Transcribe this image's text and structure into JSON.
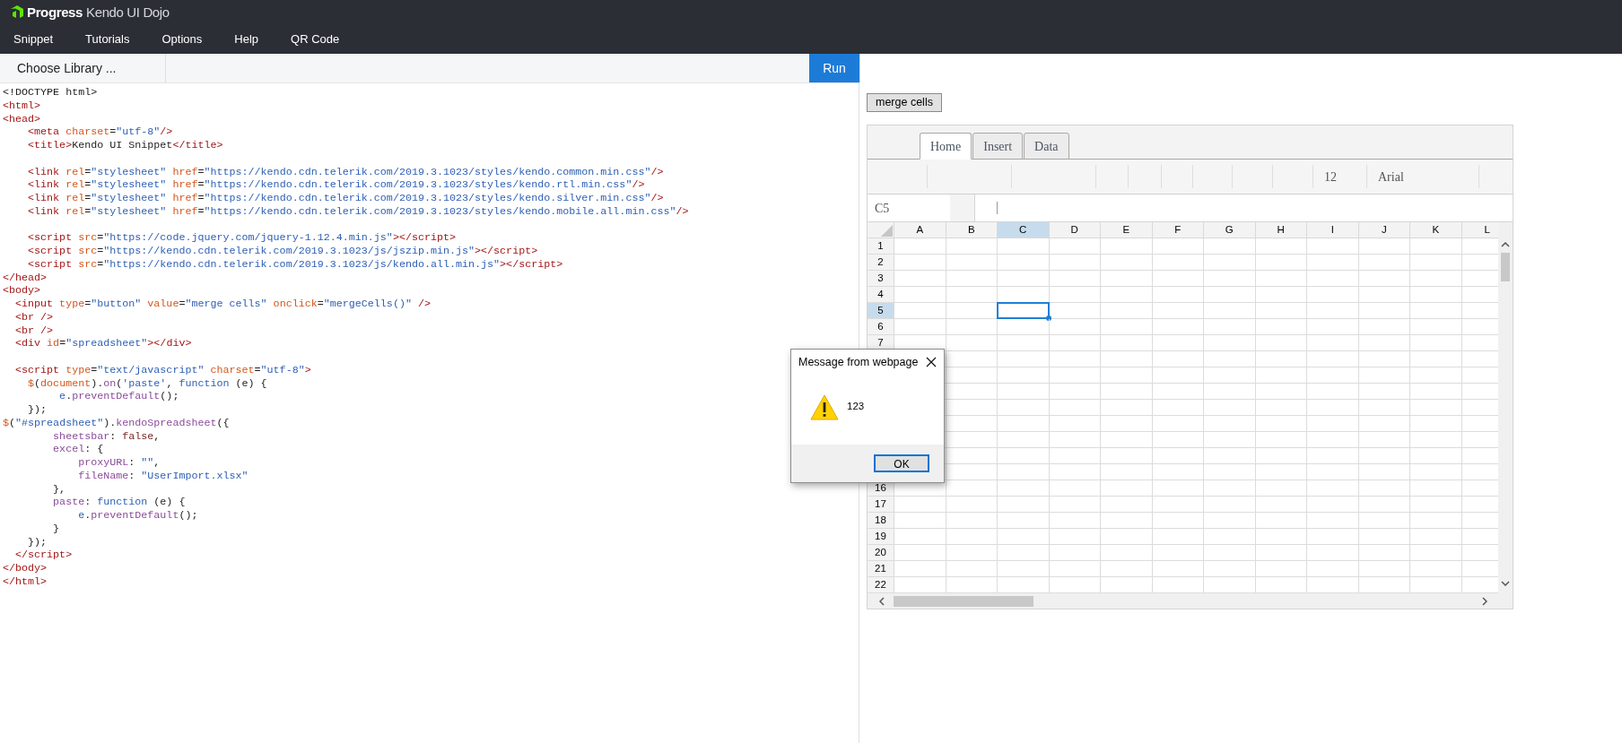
{
  "header": {
    "logo": {
      "brand": "Progress",
      "product": "Kendo UI",
      "suffix": "Dojo"
    },
    "menu": [
      "Snippet",
      "Tutorials",
      "Options",
      "Help",
      "QR Code"
    ]
  },
  "toolbar": {
    "library_button": "Choose Library ...",
    "run_button": "Run"
  },
  "code_lines": [
    {
      "kind": "code",
      "tokens": [
        {
          "text": "<!DOCTYPE html>",
          "kind": "plain"
        }
      ]
    },
    {
      "kind": "code",
      "tokens": [
        {
          "text": "<html>",
          "kind": "tag"
        }
      ]
    },
    {
      "kind": "code",
      "tokens": [
        {
          "text": "<head>",
          "kind": "tag"
        }
      ]
    },
    {
      "kind": "code",
      "tokens": [
        {
          "text": "    <meta",
          "kind": "tag"
        },
        {
          "text": " charset",
          "kind": "attr"
        },
        {
          "text": "=",
          "kind": "plain"
        },
        {
          "text": "\"utf-8\"",
          "kind": "string"
        },
        {
          "text": "/>",
          "kind": "tag"
        }
      ]
    },
    {
      "kind": "code",
      "tokens": [
        {
          "text": "    <title>",
          "kind": "tag"
        },
        {
          "text": "Kendo UI Snippet",
          "kind": "plain"
        },
        {
          "text": "</title>",
          "kind": "tag"
        }
      ]
    },
    {
      "kind": "blank"
    },
    {
      "kind": "code",
      "tokens": [
        {
          "text": "    <link",
          "kind": "tag"
        },
        {
          "text": " rel",
          "kind": "attr"
        },
        {
          "text": "=",
          "kind": "plain"
        },
        {
          "text": "\"stylesheet\"",
          "kind": "string"
        },
        {
          "text": " href",
          "kind": "attr"
        },
        {
          "text": "=",
          "kind": "plain"
        },
        {
          "text": "\"https://kendo.cdn.telerik.com/2019.3.1023/styles/kendo.common.min.css\"",
          "kind": "string"
        },
        {
          "text": "/>",
          "kind": "tag"
        }
      ]
    },
    {
      "kind": "code",
      "tokens": [
        {
          "text": "    <link",
          "kind": "tag"
        },
        {
          "text": " rel",
          "kind": "attr"
        },
        {
          "text": "=",
          "kind": "plain"
        },
        {
          "text": "\"stylesheet\"",
          "kind": "string"
        },
        {
          "text": " href",
          "kind": "attr"
        },
        {
          "text": "=",
          "kind": "plain"
        },
        {
          "text": "\"https://kendo.cdn.telerik.com/2019.3.1023/styles/kendo.rtl.min.css\"",
          "kind": "string"
        },
        {
          "text": "/>",
          "kind": "tag"
        }
      ]
    },
    {
      "kind": "code",
      "tokens": [
        {
          "text": "    <link",
          "kind": "tag"
        },
        {
          "text": " rel",
          "kind": "attr"
        },
        {
          "text": "=",
          "kind": "plain"
        },
        {
          "text": "\"stylesheet\"",
          "kind": "string"
        },
        {
          "text": " href",
          "kind": "attr"
        },
        {
          "text": "=",
          "kind": "plain"
        },
        {
          "text": "\"https://kendo.cdn.telerik.com/2019.3.1023/styles/kendo.silver.min.css\"",
          "kind": "string"
        },
        {
          "text": "/>",
          "kind": "tag"
        }
      ]
    },
    {
      "kind": "code",
      "tokens": [
        {
          "text": "    <link",
          "kind": "tag"
        },
        {
          "text": " rel",
          "kind": "attr"
        },
        {
          "text": "=",
          "kind": "plain"
        },
        {
          "text": "\"stylesheet\"",
          "kind": "string"
        },
        {
          "text": " href",
          "kind": "attr"
        },
        {
          "text": "=",
          "kind": "plain"
        },
        {
          "text": "\"https://kendo.cdn.telerik.com/2019.3.1023/styles/kendo.mobile.all.min.css\"",
          "kind": "string"
        },
        {
          "text": "/>",
          "kind": "tag"
        }
      ]
    },
    {
      "kind": "blank"
    },
    {
      "kind": "code",
      "tokens": [
        {
          "text": "    <script",
          "kind": "tag"
        },
        {
          "text": " src",
          "kind": "attr"
        },
        {
          "text": "=",
          "kind": "plain"
        },
        {
          "text": "\"https://code.jquery.com/jquery-1.12.4.min.js\"",
          "kind": "string"
        },
        {
          "text": "></script>",
          "kind": "tag"
        }
      ]
    },
    {
      "kind": "code",
      "tokens": [
        {
          "text": "    <script",
          "kind": "tag"
        },
        {
          "text": " src",
          "kind": "attr"
        },
        {
          "text": "=",
          "kind": "plain"
        },
        {
          "text": "\"https://kendo.cdn.telerik.com/2019.3.1023/js/jszip.min.js\"",
          "kind": "string"
        },
        {
          "text": "></script>",
          "kind": "tag"
        }
      ]
    },
    {
      "kind": "code",
      "tokens": [
        {
          "text": "    <script",
          "kind": "tag"
        },
        {
          "text": " src",
          "kind": "attr"
        },
        {
          "text": "=",
          "kind": "plain"
        },
        {
          "text": "\"https://kendo.cdn.telerik.com/2019.3.1023/js/kendo.all.min.js\"",
          "kind": "string"
        },
        {
          "text": "></script>",
          "kind": "tag"
        }
      ]
    },
    {
      "kind": "code",
      "tokens": [
        {
          "text": "</head>",
          "kind": "tag"
        }
      ]
    },
    {
      "kind": "code",
      "tokens": [
        {
          "text": "<body>",
          "kind": "tag"
        }
      ]
    },
    {
      "kind": "code",
      "tokens": [
        {
          "text": "  <input",
          "kind": "tag"
        },
        {
          "text": " type",
          "kind": "attr"
        },
        {
          "text": "=",
          "kind": "plain"
        },
        {
          "text": "\"button\"",
          "kind": "string"
        },
        {
          "text": " value",
          "kind": "attr"
        },
        {
          "text": "=",
          "kind": "plain"
        },
        {
          "text": "\"merge cells\"",
          "kind": "string"
        },
        {
          "text": " onclick",
          "kind": "attr"
        },
        {
          "text": "=",
          "kind": "plain"
        },
        {
          "text": "\"mergeCells()\"",
          "kind": "string"
        },
        {
          "text": " />",
          "kind": "tag"
        }
      ]
    },
    {
      "kind": "code",
      "tokens": [
        {
          "text": "  <br />",
          "kind": "tag"
        }
      ]
    },
    {
      "kind": "code",
      "tokens": [
        {
          "text": "  <br />",
          "kind": "tag"
        }
      ]
    },
    {
      "kind": "code",
      "tokens": [
        {
          "text": "  <div",
          "kind": "tag"
        },
        {
          "text": " id",
          "kind": "attr"
        },
        {
          "text": "=",
          "kind": "plain"
        },
        {
          "text": "\"spreadsheet\"",
          "kind": "string"
        },
        {
          "text": "></div>",
          "kind": "tag"
        }
      ]
    },
    {
      "kind": "blank"
    },
    {
      "kind": "code",
      "tokens": [
        {
          "text": "  <script",
          "kind": "tag"
        },
        {
          "text": " type",
          "kind": "attr"
        },
        {
          "text": "=",
          "kind": "plain"
        },
        {
          "text": "\"text/javascript\"",
          "kind": "string"
        },
        {
          "text": " charset",
          "kind": "attr"
        },
        {
          "text": "=",
          "kind": "plain"
        },
        {
          "text": "\"utf-8\"",
          "kind": "string"
        },
        {
          "text": ">",
          "kind": "tag"
        }
      ]
    },
    {
      "kind": "code",
      "tokens": [
        {
          "text": "    $",
          "kind": "attr"
        },
        {
          "text": "(",
          "kind": "plain"
        },
        {
          "text": "document",
          "kind": "attr"
        },
        {
          "text": ").",
          "kind": "plain"
        },
        {
          "text": "on",
          "kind": "member"
        },
        {
          "text": "(",
          "kind": "plain"
        },
        {
          "text": "'paste'",
          "kind": "string"
        },
        {
          "text": ", ",
          "kind": "plain"
        },
        {
          "text": "function",
          "kind": "keyword"
        },
        {
          "text": " (e) {",
          "kind": "plain"
        }
      ]
    },
    {
      "kind": "code",
      "tokens": [
        {
          "text": "         e",
          "kind": "keyword"
        },
        {
          "text": ".",
          "kind": "plain"
        },
        {
          "text": "preventDefault",
          "kind": "member"
        },
        {
          "text": "();",
          "kind": "plain"
        }
      ]
    },
    {
      "kind": "code",
      "tokens": [
        {
          "text": "    });",
          "kind": "plain"
        }
      ]
    },
    {
      "kind": "code",
      "tokens": [
        {
          "text": "$",
          "kind": "attr"
        },
        {
          "text": "(",
          "kind": "plain"
        },
        {
          "text": "\"#spreadsheet\"",
          "kind": "string"
        },
        {
          "text": ").",
          "kind": "plain"
        },
        {
          "text": "kendoSpreadsheet",
          "kind": "member"
        },
        {
          "text": "({",
          "kind": "plain"
        }
      ]
    },
    {
      "kind": "code",
      "tokens": [
        {
          "text": "        sheetsbar",
          "kind": "member"
        },
        {
          "text": ": ",
          "kind": "plain"
        },
        {
          "text": "false",
          "kind": "literal"
        },
        {
          "text": ",",
          "kind": "plain"
        }
      ]
    },
    {
      "kind": "code",
      "tokens": [
        {
          "text": "        excel",
          "kind": "member"
        },
        {
          "text": ": {",
          "kind": "plain"
        }
      ]
    },
    {
      "kind": "code",
      "tokens": [
        {
          "text": "            proxyURL",
          "kind": "member"
        },
        {
          "text": ": ",
          "kind": "plain"
        },
        {
          "text": "\"\"",
          "kind": "string"
        },
        {
          "text": ",",
          "kind": "plain"
        }
      ]
    },
    {
      "kind": "code",
      "tokens": [
        {
          "text": "            fileName",
          "kind": "member"
        },
        {
          "text": ": ",
          "kind": "plain"
        },
        {
          "text": "\"UserImport.xlsx\"",
          "kind": "string"
        }
      ]
    },
    {
      "kind": "code",
      "tokens": [
        {
          "text": "        },",
          "kind": "plain"
        }
      ]
    },
    {
      "kind": "code",
      "tokens": [
        {
          "text": "        paste",
          "kind": "member"
        },
        {
          "text": ": ",
          "kind": "plain"
        },
        {
          "text": "function",
          "kind": "keyword"
        },
        {
          "text": " (e) {",
          "kind": "plain"
        }
      ]
    },
    {
      "kind": "code",
      "tokens": [
        {
          "text": "            e",
          "kind": "keyword"
        },
        {
          "text": ".",
          "kind": "plain"
        },
        {
          "text": "preventDefault",
          "kind": "member"
        },
        {
          "text": "();",
          "kind": "plain"
        }
      ]
    },
    {
      "kind": "code",
      "tokens": [
        {
          "text": "        }",
          "kind": "plain"
        }
      ]
    },
    {
      "kind": "code",
      "tokens": [
        {
          "text": "    });",
          "kind": "plain"
        }
      ]
    },
    {
      "kind": "code",
      "tokens": [
        {
          "text": "  </script>",
          "kind": "tag"
        }
      ]
    },
    {
      "kind": "code",
      "tokens": [
        {
          "text": "</body>",
          "kind": "tag"
        }
      ]
    },
    {
      "kind": "code",
      "tokens": [
        {
          "text": "</html>",
          "kind": "tag"
        }
      ]
    }
  ],
  "preview": {
    "merge_button": "merge cells",
    "spreadsheet": {
      "tabs": [
        {
          "label": "Home",
          "selected": true
        },
        {
          "label": "Insert",
          "selected": false
        },
        {
          "label": "Data",
          "selected": false
        }
      ],
      "font_size": "12",
      "font_name": "Arial",
      "name_box": "C5",
      "columns": [
        {
          "label": "A",
          "selected": false
        },
        {
          "label": "B",
          "selected": false
        },
        {
          "label": "C",
          "selected": true
        },
        {
          "label": "D",
          "selected": false
        },
        {
          "label": "E",
          "selected": false
        },
        {
          "label": "F",
          "selected": false
        },
        {
          "label": "G",
          "selected": false
        },
        {
          "label": "H",
          "selected": false
        },
        {
          "label": "I",
          "selected": false
        },
        {
          "label": "J",
          "selected": false
        },
        {
          "label": "K",
          "selected": false
        },
        {
          "label": "L",
          "selected": false
        }
      ],
      "rows_above_dialog": [
        {
          "label": "1",
          "selected": false
        },
        {
          "label": "2",
          "selected": false
        },
        {
          "label": "3",
          "selected": false
        },
        {
          "label": "4",
          "selected": false
        },
        {
          "label": "5",
          "selected": true
        },
        {
          "label": "6",
          "selected": false
        },
        {
          "label": "7",
          "selected": false
        }
      ],
      "rows_below_dialog": [
        {
          "label": "16",
          "selected": false
        },
        {
          "label": "17",
          "selected": false
        },
        {
          "label": "18",
          "selected": false
        },
        {
          "label": "19",
          "selected": false
        },
        {
          "label": "20",
          "selected": false
        },
        {
          "label": "21",
          "selected": false
        },
        {
          "label": "22",
          "selected": false
        }
      ]
    }
  },
  "dialog": {
    "title": "Message from webpage",
    "message": "123",
    "ok_button": "OK"
  }
}
